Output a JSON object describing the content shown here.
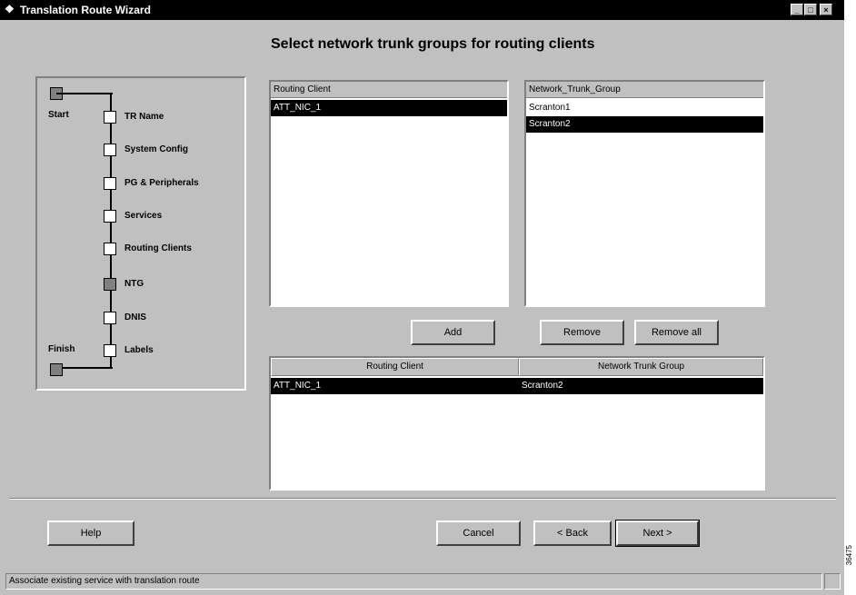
{
  "window": {
    "title": "Translation Route Wizard",
    "controls": [
      "minimize",
      "maximize",
      "close"
    ]
  },
  "heading": "Select network trunk groups for routing clients",
  "steps": {
    "start_label": "Start",
    "finish_label": "Finish",
    "items": [
      {
        "label": "TR Name",
        "state": "pending"
      },
      {
        "label": "System Config",
        "state": "pending"
      },
      {
        "label": "PG & Peripherals",
        "state": "pending"
      },
      {
        "label": "Services",
        "state": "pending"
      },
      {
        "label": "Routing Clients",
        "state": "pending"
      },
      {
        "label": "NTG",
        "state": "current"
      },
      {
        "label": "DNIS",
        "state": "pending"
      },
      {
        "label": "Labels",
        "state": "pending"
      }
    ]
  },
  "routing_client_list": {
    "header": "Routing Client",
    "items": [
      {
        "text": "ATT_NIC_1",
        "selected": true
      }
    ]
  },
  "trunk_group_list": {
    "header": "Network_Trunk_Group",
    "items": [
      {
        "text": "Scranton1",
        "selected": false
      },
      {
        "text": "Scranton2",
        "selected": true
      }
    ]
  },
  "buttons": {
    "add": "Add",
    "remove": "Remove",
    "remove_all": "Remove all",
    "help": "Help",
    "cancel": "Cancel",
    "back": "< Back",
    "next": "Next >"
  },
  "mapping_table": {
    "columns": [
      "Routing Client",
      "Network Trunk Group"
    ],
    "rows": [
      {
        "routing_client": "ATT_NIC_1",
        "trunk_group": "Scranton2",
        "selected": true
      }
    ]
  },
  "status_bar": "Associate existing service with translation route",
  "side_code": "36475"
}
